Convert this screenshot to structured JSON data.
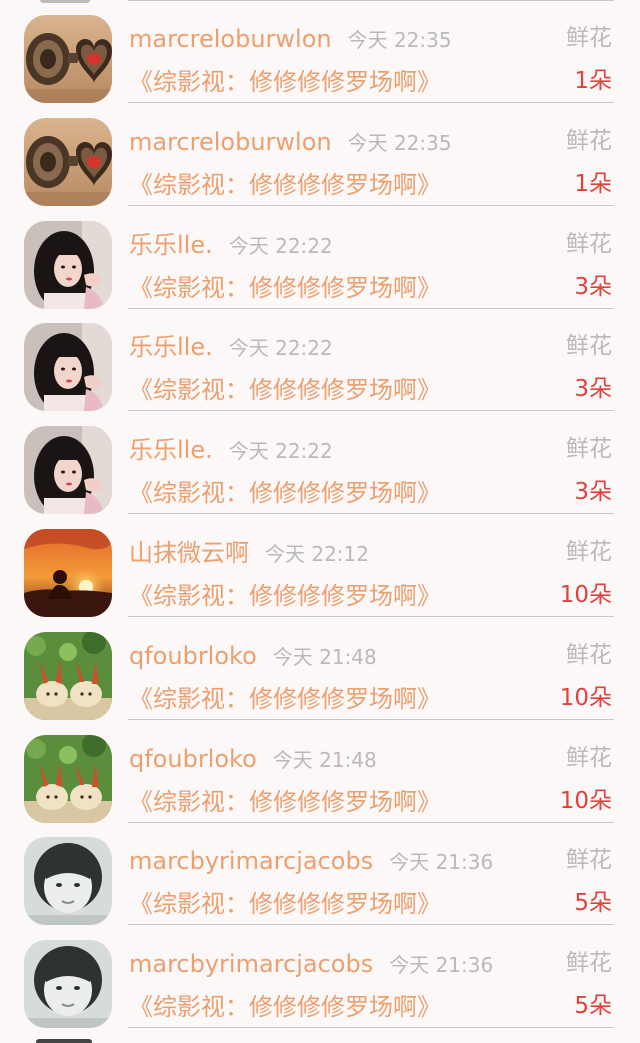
{
  "gift_list": {
    "rows": [
      {
        "user": "marcreloburwlon",
        "time": "今天 22:35",
        "gift_label": "鲜花",
        "work_title": "《综影视：修修修修罗场啊》",
        "count": "1朵",
        "avatar": "heart-mask"
      },
      {
        "user": "marcreloburwlon",
        "time": "今天 22:35",
        "gift_label": "鲜花",
        "work_title": "《综影视：修修修修罗场啊》",
        "count": "1朵",
        "avatar": "heart-mask"
      },
      {
        "user": "乐乐lle.",
        "time": "今天 22:22",
        "gift_label": "鲜花",
        "work_title": "《综影视：修修修修罗场啊》",
        "count": "3朵",
        "avatar": "girl-portrait"
      },
      {
        "user": "乐乐lle.",
        "time": "今天 22:22",
        "gift_label": "鲜花",
        "work_title": "《综影视：修修修修罗场啊》",
        "count": "3朵",
        "avatar": "girl-portrait"
      },
      {
        "user": "乐乐lle.",
        "time": "今天 22:22",
        "gift_label": "鲜花",
        "work_title": "《综影视：修修修修罗场啊》",
        "count": "3朵",
        "avatar": "girl-portrait"
      },
      {
        "user": "山抹微云啊",
        "time": "今天 22:12",
        "gift_label": "鲜花",
        "work_title": "《综影视：修修修修罗场啊》",
        "count": "10朵",
        "avatar": "sunset"
      },
      {
        "user": "qfoubrloko",
        "time": "今天 21:48",
        "gift_label": "鲜花",
        "work_title": "《综影视：修修修修罗场啊》",
        "count": "10朵",
        "avatar": "bunny-pair"
      },
      {
        "user": "qfoubrloko",
        "time": "今天 21:48",
        "gift_label": "鲜花",
        "work_title": "《综影视：修修修修罗场啊》",
        "count": "10朵",
        "avatar": "bunny-pair"
      },
      {
        "user": "marcbyrimarcjacobs",
        "time": "今天 21:36",
        "gift_label": "鲜花",
        "work_title": "《综影视：修修修修罗场啊》",
        "count": "5朵",
        "avatar": "child-bw"
      },
      {
        "user": "marcbyrimarcjacobs",
        "time": "今天 21:36",
        "gift_label": "鲜花",
        "work_title": "《综影视：修修修修罗场啊》",
        "count": "5朵",
        "avatar": "child-bw"
      }
    ]
  },
  "colors": {
    "background": "#fcf8f8",
    "accent_orange": "#ec9f6f",
    "count_red": "#e0413d",
    "muted_gray": "#b9b9b9"
  }
}
